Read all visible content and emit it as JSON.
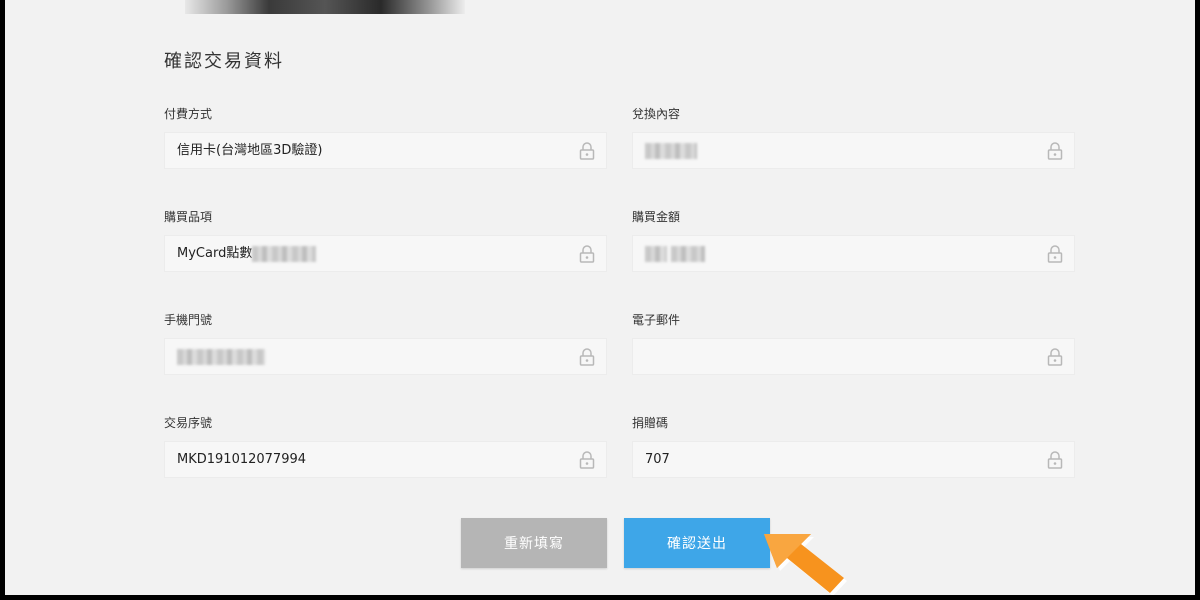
{
  "page": {
    "title": "確認交易資料"
  },
  "fields": {
    "payment_method": {
      "label": "付費方式",
      "value": "信用卡(台灣地區3D驗證)"
    },
    "redeem_content": {
      "label": "兌換內容",
      "value": ""
    },
    "purchase_item": {
      "label": "購買品項",
      "value": "MyCard點數"
    },
    "purchase_amount": {
      "label": "購買金額",
      "value": ""
    },
    "phone_number": {
      "label": "手機門號",
      "value": ""
    },
    "email": {
      "label": "電子郵件",
      "value": ""
    },
    "transaction_id": {
      "label": "交易序號",
      "value": "MKD191012077994"
    },
    "donation_code": {
      "label": "捐贈碼",
      "value": "707"
    }
  },
  "buttons": {
    "reset_label": "重新填寫",
    "submit_label": "確認送出"
  },
  "colors": {
    "submit_button": "#3ea6e8",
    "reset_button": "#b5b5b5",
    "arrow": "#f7931e",
    "background": "#f2f2f2"
  },
  "icons": {
    "lock": "lock-icon",
    "pointer_arrow": "arrow-icon"
  }
}
